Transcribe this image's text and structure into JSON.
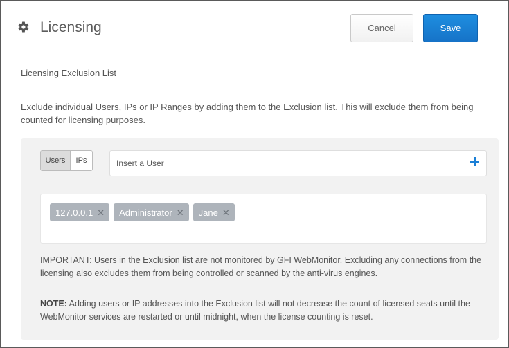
{
  "header": {
    "title": "Licensing",
    "cancel_label": "Cancel",
    "save_label": "Save",
    "icon": "gear-icon"
  },
  "section": {
    "title": "Licensing Exclusion List",
    "description": "Exclude individual Users, IPs or IP Ranges by adding them to the Exclusion list. This will exclude them from being counted for licensing purposes."
  },
  "panel": {
    "toggle": {
      "users_label": "Users",
      "ips_label": "IPs",
      "selected": "Users"
    },
    "input": {
      "placeholder": "Insert a User",
      "value": ""
    },
    "add_icon": "plus-icon",
    "tags": [
      {
        "label": "127.0.0.1"
      },
      {
        "label": "Administrator"
      },
      {
        "label": "Jane"
      }
    ],
    "important": "IMPORTANT: Users in the Exclusion list are not monitored by GFI WebMonitor. Excluding any connections from the licensing also excludes them from being controlled or scanned by the anti-virus engines.",
    "note_label": "NOTE:",
    "note_text": " Adding users or IP addresses into the Exclusion list will not decrease the count of licensed seats until the WebMonitor services are restarted or until midnight, when the license counting is reset."
  },
  "colors": {
    "accent": "#1a7fd6",
    "tag_bg": "#aeb4bb",
    "panel_bg": "#f2f2f2"
  }
}
